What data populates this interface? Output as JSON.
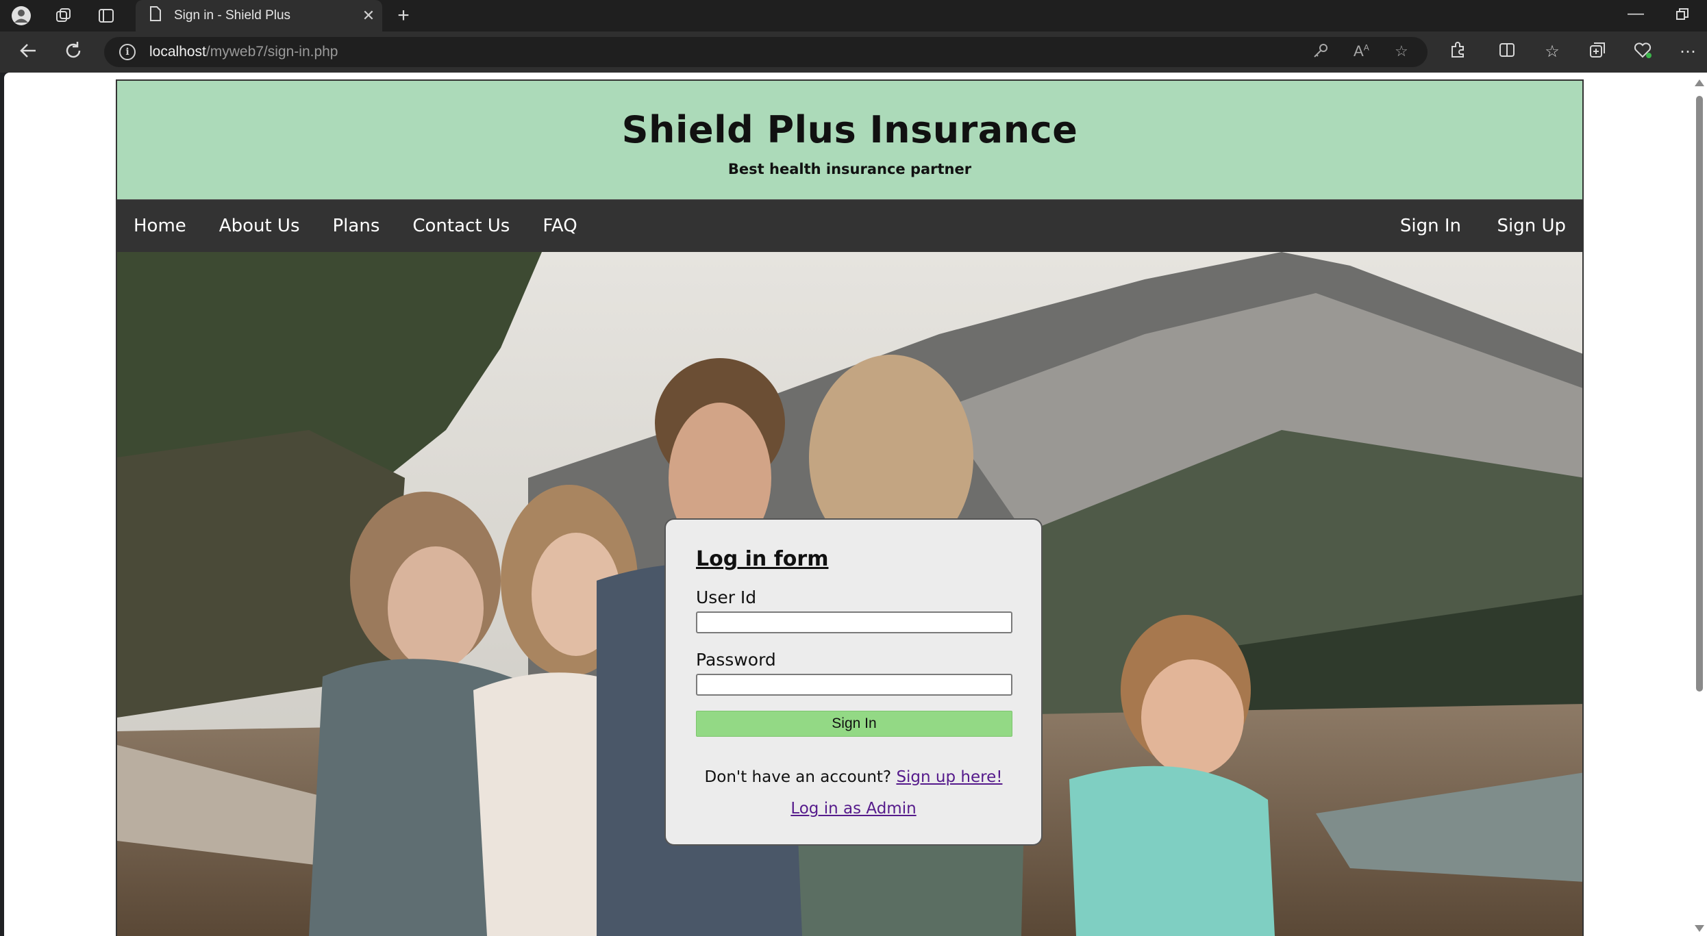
{
  "browser": {
    "tab_title": "Sign in - Shield Plus",
    "url_host": "localhost",
    "url_path": "/myweb7/sign-in.php",
    "icons": [
      "profile-icon",
      "workspaces-icon",
      "tab-actions-icon",
      "page-icon",
      "close-icon",
      "new-tab-icon",
      "minimize-icon",
      "restore-icon",
      "back-icon",
      "refresh-icon",
      "info-icon",
      "key-icon",
      "read-aloud-icon",
      "favorite-star-icon",
      "extensions-icon",
      "split-screen-icon",
      "favorites-icon",
      "collections-icon",
      "health-icon",
      "more-icon"
    ]
  },
  "site": {
    "title": "Shield Plus Insurance",
    "tagline": "Best health insurance partner",
    "colors": {
      "header_bg": "#acdab9",
      "nav_bg": "#333333",
      "signin_button": "#93d985",
      "link": "#551a8b"
    },
    "nav_left": [
      "Home",
      "About Us",
      "Plans",
      "Contact Us",
      "FAQ"
    ],
    "nav_right": [
      "Sign In",
      "Sign Up"
    ]
  },
  "login_form": {
    "heading": "Log in form",
    "user_id_label": "User Id",
    "user_id_value": "",
    "password_label": "Password",
    "password_value": "",
    "submit_label": "Sign In",
    "no_account_text": "Don't have an account?",
    "signup_link": "Sign up here!",
    "admin_link": "Log in as Admin"
  }
}
